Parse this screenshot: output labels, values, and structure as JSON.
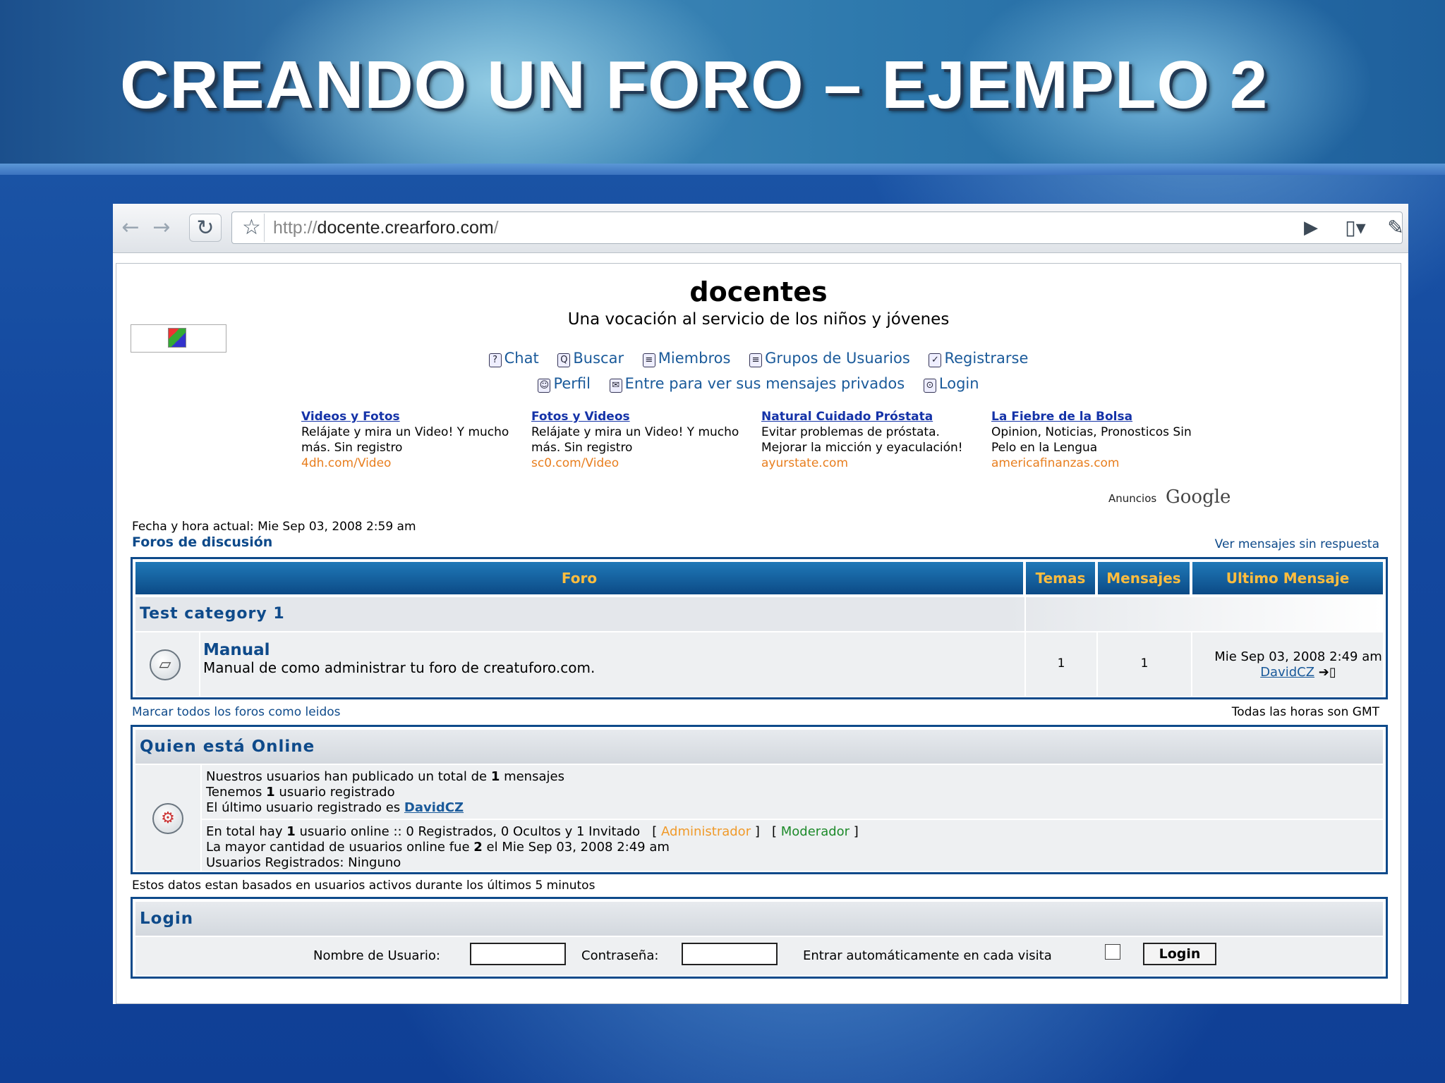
{
  "slide": {
    "title": "CREANDO UN FORO – EJEMPLO  2"
  },
  "browser": {
    "url_prefix": "http://",
    "url_host": "docente.crearforo.com",
    "url_suffix": "/"
  },
  "site": {
    "title": "docentes",
    "description": "Una vocación al servicio de los niños y jóvenes"
  },
  "nav": {
    "row1": [
      {
        "label": "Chat",
        "icon": "?"
      },
      {
        "label": "Buscar",
        "icon": "Q"
      },
      {
        "label": "Miembros",
        "icon": "≡"
      },
      {
        "label": "Grupos de Usuarios",
        "icon": "≡"
      },
      {
        "label": "Registrarse",
        "icon": "✓"
      }
    ],
    "row2": [
      {
        "label": "Perfil",
        "icon": "☺"
      },
      {
        "label": "Entre para ver sus mensajes privados",
        "icon": "✉"
      },
      {
        "label": "Login",
        "icon": "⊙"
      }
    ]
  },
  "ads": [
    {
      "title": "Videos y Fotos",
      "text": "Relájate y mira un Video! Y mucho más. Sin registro",
      "url": "4dh.com/Video"
    },
    {
      "title": "Fotos y Videos",
      "text": "Relájate y mira un Video! Y mucho más. Sin registro",
      "url": "sc0.com/Video"
    },
    {
      "title": "Natural Cuidado Próstata",
      "text": "Evitar problemas de próstata. Mejorar la micción y eyaculación!",
      "url": "ayurstate.com"
    },
    {
      "title": "La Fiebre de la Bolsa",
      "text": "Opinion, Noticias, Pronosticos Sin Pelo en la Lengua",
      "url": "americafinanzas.com"
    }
  ],
  "ads_label": "Anuncios",
  "ads_brand": "Google",
  "forum_index": {
    "datetime": "Fecha y hora actual: Mie Sep 03, 2008 2:59 am",
    "index_link": "Foros de discusión",
    "unanswered_link": "Ver mensajes sin respuesta",
    "columns": {
      "forum": "Foro",
      "topics": "Temas",
      "posts": "Mensajes",
      "last_post": "Ultimo Mensaje"
    },
    "category": "Test category 1",
    "forum": {
      "name": "Manual",
      "description": "Manual de como administrar tu foro de creatuforo.com.",
      "topics": "1",
      "posts": "1",
      "last_post_date": "Mie Sep 03, 2008 2:49 am",
      "last_post_user": "DavidCZ"
    },
    "mark_read": "Marcar todos los foros como leidos",
    "timezone_note": "Todas las horas son GMT"
  },
  "online": {
    "header": "Quien está Online",
    "posts_pre": "Nuestros usuarios han publicado un total de",
    "posts_count": "1",
    "posts_post": "mensajes",
    "users_pre": "Tenemos",
    "users_count": "1",
    "users_post": "usuario registrado",
    "newest_pre": "El último usuario registrado es",
    "newest_user": "DavidCZ",
    "total_pre": "En total hay",
    "total_count": "1",
    "total_post": "usuario online :: 0 Registrados, 0 Ocultos y 1 Invitado",
    "admin_label": "Administrador",
    "mod_label": "Moderador",
    "max_pre": "La mayor cantidad de usuarios online fue",
    "max_count": "2",
    "max_post": "el Mie Sep 03, 2008 2:49 am",
    "registered": "Usuarios Registrados: Ninguno",
    "note": "Estos datos estan basados en usuarios activos durante los últimos 5 minutos"
  },
  "login": {
    "header": "Login",
    "username_label": "Nombre de Usuario:",
    "password_label": "Contraseña:",
    "autologin_label": "Entrar automáticamente en cada visita",
    "button": "Login"
  },
  "colors": {
    "accent": "#0e4a8a",
    "header_text": "#ffbd3e",
    "ad_title": "#1533a8",
    "ad_url": "#e87e1e"
  }
}
